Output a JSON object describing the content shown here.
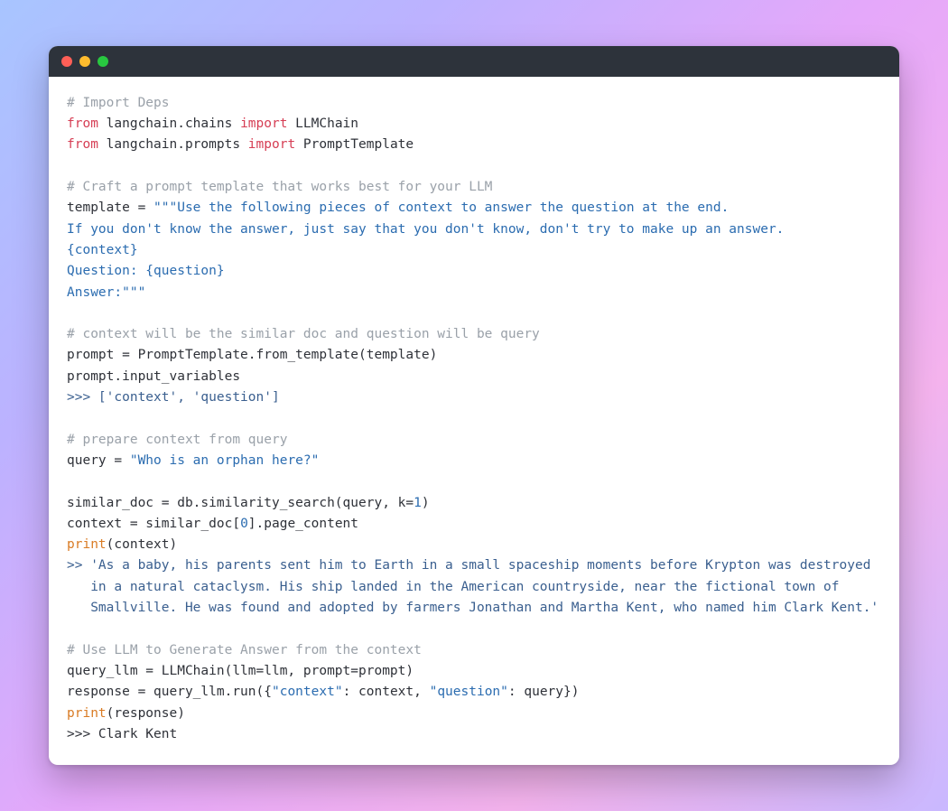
{
  "titlebar": {
    "dots": [
      "red",
      "yellow",
      "green"
    ]
  },
  "code": {
    "l01_comment": "# Import Deps",
    "l02_from": "from",
    "l02_mod": " langchain.chains ",
    "l02_import": "import",
    "l02_sym": " LLMChain",
    "l03_from": "from",
    "l03_mod": " langchain.prompts ",
    "l03_import": "import",
    "l03_sym": " PromptTemplate",
    "l05_comment": "# Craft a prompt template that works best for your LLM",
    "l06_lhs": "template = ",
    "l06_str": "\"\"\"Use the following pieces of context to answer the question at the end.",
    "l07_str": "If you don't know the answer, just say that you don't know, don't try to make up an answer.",
    "l08_str": "{context}",
    "l09_str": "Question: {question}",
    "l10_str": "Answer:\"\"\"",
    "l12_comment": "# context will be the similar doc and question will be query",
    "l13": "prompt = PromptTemplate.from_template(template)",
    "l14": "prompt.input_variables",
    "l15_prompt": ">>> ",
    "l15_out": "['context', 'question']",
    "l17_comment": "# prepare context from query",
    "l18_lhs": "query = ",
    "l18_str": "\"Who is an orphan here?\"",
    "l20_a": "similar_doc = db.similarity_search(query, k=",
    "l20_k": "1",
    "l20_b": ")",
    "l21_a": "context = similar_doc[",
    "l21_idx": "0",
    "l21_b": "].page_content",
    "l22_print": "print",
    "l22_args": "(context)",
    "l23_out1": ">> 'As a baby, his parents sent him to Earth in a small spaceship moments before Krypton was destroyed",
    "l24_out2": "   in a natural cataclysm. His ship landed in the American countryside, near the fictional town of",
    "l25_out3": "   Smallville. He was found and adopted by farmers Jonathan and Martha Kent, who named him Clark Kent.'",
    "l27_comment": "# Use LLM to Generate Answer from the context",
    "l28": "query_llm = LLMChain(llm=llm, prompt=prompt)",
    "l29_a": "response = query_llm.run({",
    "l29_k1": "\"context\"",
    "l29_b": ": context, ",
    "l29_k2": "\"question\"",
    "l29_c": ": query})",
    "l30_print": "print",
    "l30_args": "(response)",
    "l31_prompt": ">>> ",
    "l31_out": "Clark Kent"
  }
}
